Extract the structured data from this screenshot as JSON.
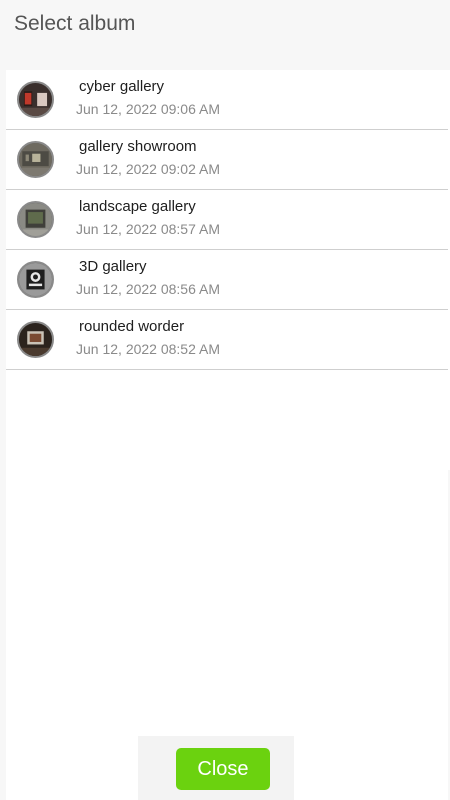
{
  "dialog": {
    "title": "Select album",
    "close_label": "Close",
    "accent_color": "#6bd20f"
  },
  "albums": [
    {
      "name": "cyber gallery",
      "date": "Jun 12, 2022 09:06 AM",
      "thumbnail": "gallery-thumbnail"
    },
    {
      "name": "gallery showroom",
      "date": "Jun 12, 2022 09:02 AM",
      "thumbnail": "gallery-thumbnail"
    },
    {
      "name": "landscape gallery",
      "date": "Jun 12, 2022 08:57 AM",
      "thumbnail": "gallery-thumbnail"
    },
    {
      "name": "3D gallery",
      "date": "Jun 12, 2022 08:56 AM",
      "thumbnail": "gallery-thumbnail"
    },
    {
      "name": "rounded worder",
      "date": "Jun 12, 2022 08:52 AM",
      "thumbnail": "gallery-thumbnail"
    }
  ]
}
